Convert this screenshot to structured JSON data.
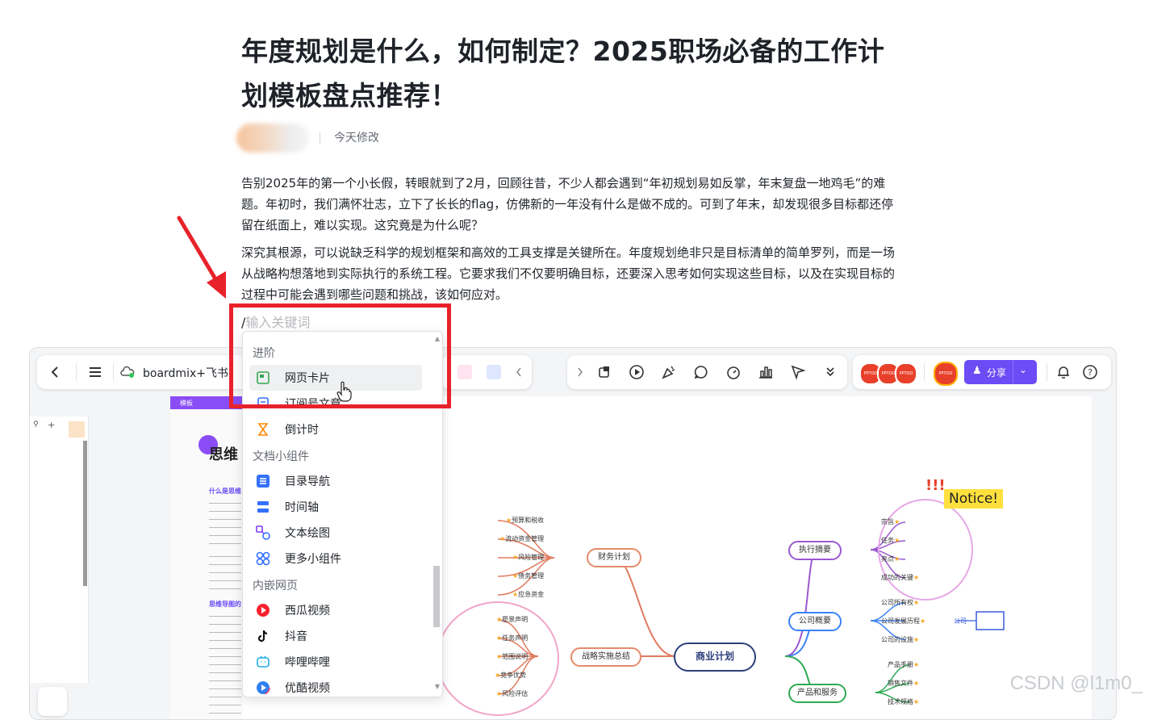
{
  "article": {
    "title": "年度规划是什么，如何制定？2025职场必备的工作计划模板盘点推荐！",
    "modified": "今天修改",
    "paragraph1": "告别2025年的第一个小长假，转眼就到了2月，回顾往昔，不少人都会遇到“年初规划易如反掌，年末复盘一地鸡毛”的难题。年初时，我们满怀壮志，立下了长长的flag，仿佛新的一年没有什么是做不成的。可到了年末，却发现很多目标都还停留在纸面上，难以实现。这究竟是为什么呢？",
    "paragraph2": "深究其根源，可以说缺乏科学的规划框架和高效的工具支撑是关键所在。年度规划绝非只是目标清单的简单罗列，而是一场从战略构想落地到实际执行的系统工程。它要求我们不仅要明确目标，还要深入思考如何实现这些目标，以及在实现目标的过程中可能会遇到哪些问题和挑战，该如何应对。"
  },
  "slash_command": {
    "slash": "/",
    "placeholder": "输入关键词"
  },
  "dropdown": {
    "groups": [
      {
        "label": "进阶"
      },
      {
        "label": "文档小组件"
      },
      {
        "label": "内嵌网页"
      }
    ],
    "items": [
      {
        "label": "网页卡片",
        "icon": "web-card-icon",
        "color": "#34a853"
      },
      {
        "label": "订阅号文章",
        "icon": "article-icon",
        "color": "#3370ff"
      },
      {
        "label": "倒计时",
        "icon": "hourglass-icon",
        "color": "#ff8800"
      },
      {
        "label": "目录导航",
        "icon": "toc-icon",
        "color": "#3370ff"
      },
      {
        "label": "时间轴",
        "icon": "timeline-icon",
        "color": "#3370ff"
      },
      {
        "label": "文本绘图",
        "icon": "text-drawing-icon",
        "color": "#7f3bf5"
      },
      {
        "label": "更多小组件",
        "icon": "widgets-icon",
        "color": "#3370ff"
      },
      {
        "label": "西瓜视频",
        "icon": "xigua-icon",
        "color": "#f5222d"
      },
      {
        "label": "抖音",
        "icon": "douyin-icon",
        "color": "#111111"
      },
      {
        "label": "哔哩哔哩",
        "icon": "bilibili-icon",
        "color": "#23ade5"
      },
      {
        "label": "优酷视频",
        "icon": "youku-icon",
        "color": "#2f80ed"
      }
    ]
  },
  "embed": {
    "app_name": "boardmix+飞书",
    "share_label": "分享",
    "template_label": "模板",
    "doc_heading": "思维",
    "doc_sub1": "什么是思维",
    "doc_sub2": "思维导图的",
    "avatars": [
      "PPTOO",
      "PPTOO",
      "PPTOO"
    ],
    "self_avatar": "PPTOO",
    "notice": "Notice!",
    "mindmap": {
      "center": "商业计划",
      "branches": [
        {
          "label": "财务计划",
          "leaves": [
            "预算和税收",
            "流动资金管理",
            "风险管理",
            "债务管理",
            "应急资金"
          ]
        },
        {
          "label": "战略实施总结",
          "leaves": [
            "愿景声明",
            "任务声明",
            "范围说明",
            "竞争优势",
            "风险评估"
          ]
        },
        {
          "label": "执行摘要",
          "leaves": [
            "宗旨",
            "任务",
            "亮点",
            "成功的关键"
          ]
        },
        {
          "label": "公司概要",
          "leaves": [
            "公司所有权",
            "公司发展历程",
            "公司的设施"
          ],
          "tag": "公司"
        },
        {
          "label": "产品和服务",
          "leaves": [
            "产品手册",
            "销售文件",
            "技术规格"
          ]
        }
      ]
    }
  },
  "watermark": "CSDN @l1m0_"
}
